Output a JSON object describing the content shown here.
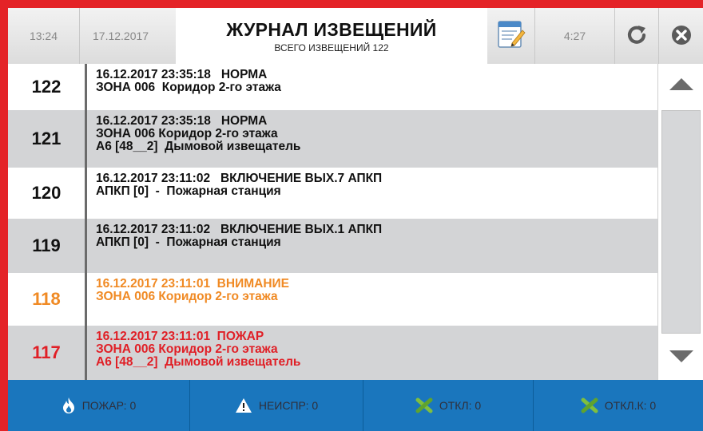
{
  "header": {
    "time": "13:24",
    "date": "17.12.2017",
    "title": "ЖУРНАЛ ИЗВЕЩЕНИЙ",
    "subtitle": "ВСЕГО ИЗВЕЩЕНИЙ 122",
    "counter": "4:27",
    "icons": [
      "notepad-icon",
      "refresh-icon",
      "close-icon"
    ]
  },
  "events": [
    {
      "number": "122",
      "color": "#111111",
      "lines": [
        "16.12.2017 23:35:18   НОРМА",
        "ЗОНА 006  Коридор 2-го этажа"
      ]
    },
    {
      "number": "121",
      "color": "#111111",
      "lines": [
        "16.12.2017 23:35:18   НОРМА",
        "ЗОНА 006 Коридор 2-го этажа",
        "А6 [48__2]  Дымовой извещатель"
      ]
    },
    {
      "number": "120",
      "color": "#111111",
      "lines": [
        "16.12.2017 23:11:02   ВКЛЮЧЕНИЕ ВЫХ.7 АПКП",
        "АПКП [0]  -  Пожарная станция"
      ]
    },
    {
      "number": "119",
      "color": "#111111",
      "lines": [
        "16.12.2017 23:11:02   ВКЛЮЧЕНИЕ ВЫХ.1 АПКП",
        "АПКП [0]  -  Пожарная станция"
      ]
    },
    {
      "number": "118",
      "color": "#f08a24",
      "lines": [
        "16.12.2017 23:11:01  ВНИМАНИЕ",
        "ЗОНА 006 Коридор 2-го этажа"
      ]
    },
    {
      "number": "117",
      "color": "#e01f26",
      "lines": [
        "16.12.2017 23:11:01  ПОЖАР",
        "ЗОНА 006 Коридор 2-го этажа",
        "А6 [48__2]  Дымовой извещатель"
      ]
    }
  ],
  "footer": {
    "fire": "ПОЖАР: 0",
    "fault": "НЕИСПР: 0",
    "off": "ОТКЛ: 0",
    "off_k": "ОТКЛ.К: 0"
  },
  "colors": {
    "frame": "#e42327",
    "footer": "#1a76bd",
    "alt_row": "#d3d4d6",
    "warning": "#f08a24",
    "fire": "#e01f26"
  }
}
